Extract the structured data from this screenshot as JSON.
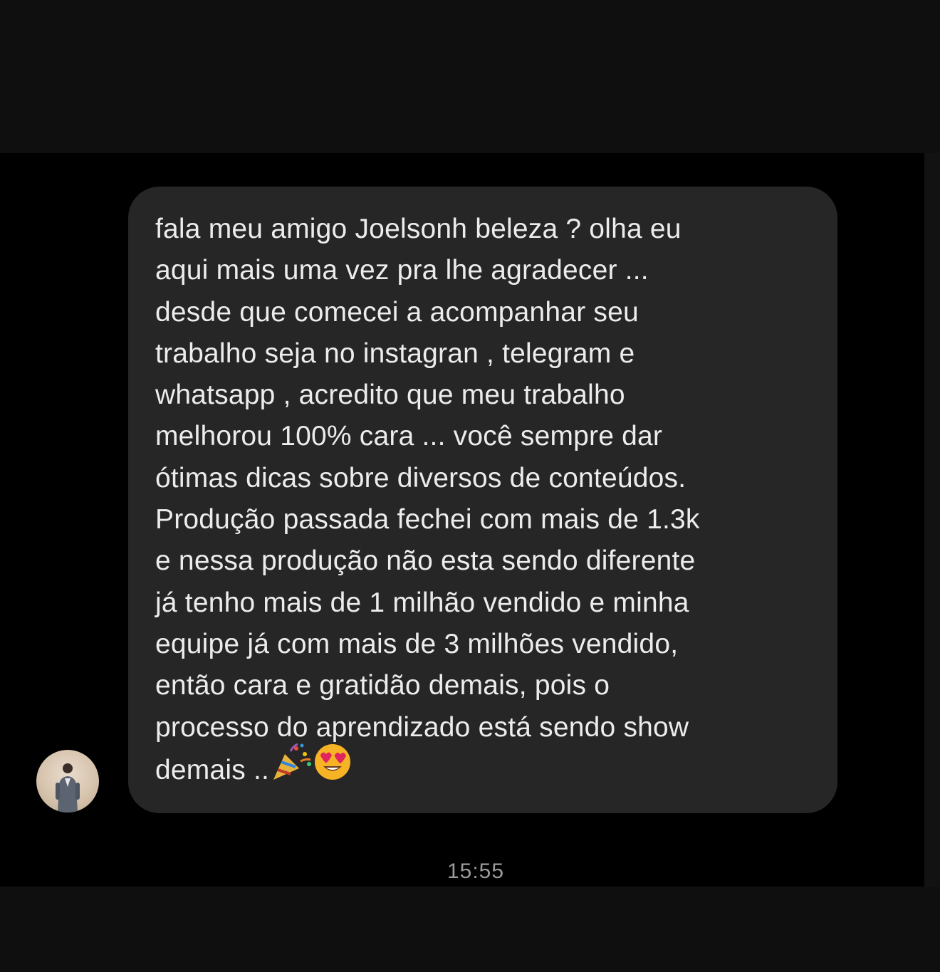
{
  "message": {
    "text": "fala meu amigo Joelsonh beleza ? olha eu\naqui mais uma vez pra lhe agradecer ...\ndesde que comecei a acompanhar seu\ntrabalho seja no instagran , telegram e\nwhatsapp , acredito que meu trabalho\nmelhorou 100% cara ...   você sempre dar\nótimas dicas sobre diversos de conteúdos.\nProdução passada fechei com mais de 1.3k\ne nessa produção não esta sendo diferente\njá tenho mais de 1 milhão vendido e minha\nequipe já com mais de 3 milhões vendido,\nentão cara e gratidão demais, pois o\nprocesso do aprendizado está sendo show\ndemais ..",
    "emojis": [
      "party-popper-icon",
      "heart-eyes-icon"
    ],
    "timestamp": "15:55"
  },
  "colors": {
    "background": "#000000",
    "bubble": "#262626",
    "text": "#ececec",
    "timestamp": "#9a9a9a"
  }
}
